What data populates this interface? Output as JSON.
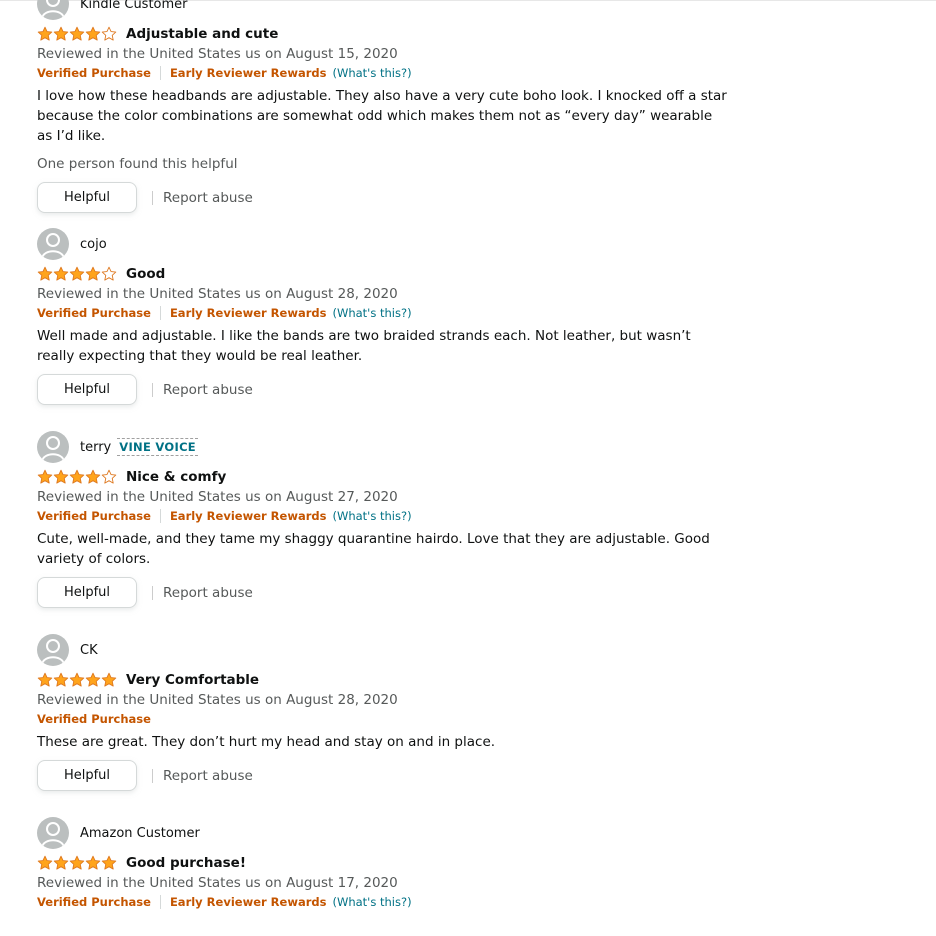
{
  "reviews": [
    {
      "name": "Kindle Customer",
      "vine": "",
      "rating": 4,
      "title": "Adjustable and cute",
      "date": "Reviewed in the United States us on August 15, 2020",
      "verified": "Verified Purchase",
      "early": "Early Reviewer Rewards",
      "whats": "(What's this?)",
      "body": "I love how these headbands are adjustable. They also have a very cute boho look. I knocked off a star because the color combinations are somewhat odd which makes them not as “every day” wearable as I’d like.",
      "found": "One person found this helpful",
      "helpful": "Helpful",
      "report": "Report abuse"
    },
    {
      "name": "cojo",
      "vine": "",
      "rating": 4,
      "title": "Good",
      "date": "Reviewed in the United States us on August 28, 2020",
      "verified": "Verified Purchase",
      "early": "Early Reviewer Rewards",
      "whats": "(What's this?)",
      "body": "Well made and adjustable. I like the bands are two braided strands each. Not leather, but wasn’t really expecting that they would be real leather.",
      "found": "",
      "helpful": "Helpful",
      "report": "Report abuse"
    },
    {
      "name": "terry",
      "vine": "VINE VOICE",
      "rating": 4,
      "title": "Nice & comfy",
      "date": "Reviewed in the United States us on August 27, 2020",
      "verified": "Verified Purchase",
      "early": "Early Reviewer Rewards",
      "whats": "(What's this?)",
      "body": "Cute, well-made, and they tame my shaggy quarantine hairdo. Love that they are adjustable. Good variety of colors.",
      "found": "",
      "helpful": "Helpful",
      "report": "Report abuse"
    },
    {
      "name": "CK",
      "vine": "",
      "rating": 5,
      "title": "Very Comfortable",
      "date": "Reviewed in the United States us on August 28, 2020",
      "verified": "Verified Purchase",
      "early": "",
      "whats": "",
      "body": "These are great. They don’t hurt my head and stay on and in place.",
      "found": "",
      "helpful": "Helpful",
      "report": "Report abuse"
    },
    {
      "name": "Amazon Customer",
      "vine": "",
      "rating": 5,
      "title": "Good purchase!",
      "date": "Reviewed in the United States us on August 17, 2020",
      "verified": "Verified Purchase",
      "early": "Early Reviewer Rewards",
      "whats": "(What's this?)",
      "body": "",
      "found": "",
      "helpful": "",
      "report": ""
    }
  ],
  "colors": {
    "star": "#ffa41c",
    "star_stroke": "#de7921",
    "badge": "#c45500",
    "link": "#007185"
  }
}
